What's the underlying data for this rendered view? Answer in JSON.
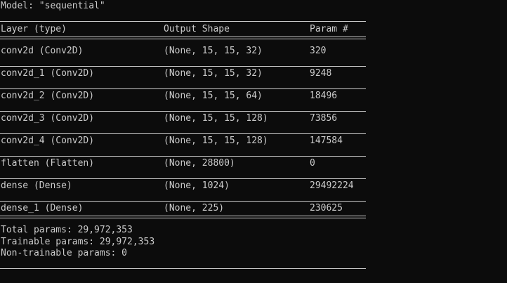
{
  "model_line": "Model: \"sequential\"",
  "header": {
    "layer": "Layer (type)",
    "output_shape": "Output Shape",
    "param": "Param #"
  },
  "layers": [
    {
      "name": "conv2d (Conv2D)",
      "shape": "(None, 15, 15, 32)",
      "param": "320"
    },
    {
      "name": "conv2d_1 (Conv2D)",
      "shape": "(None, 15, 15, 32)",
      "param": "9248"
    },
    {
      "name": "conv2d_2 (Conv2D)",
      "shape": "(None, 15, 15, 64)",
      "param": "18496"
    },
    {
      "name": "conv2d_3 (Conv2D)",
      "shape": "(None, 15, 15, 128)",
      "param": "73856"
    },
    {
      "name": "conv2d_4 (Conv2D)",
      "shape": "(None, 15, 15, 128)",
      "param": "147584"
    },
    {
      "name": "flatten (Flatten)",
      "shape": "(None, 28800)",
      "param": "0"
    },
    {
      "name": "dense (Dense)",
      "shape": "(None, 1024)",
      "param": "29492224"
    },
    {
      "name": "dense_1 (Dense)",
      "shape": "(None, 225)",
      "param": "230625"
    }
  ],
  "summary": {
    "total": "Total params: 29,972,353",
    "trainable": "Trainable params: 29,972,353",
    "non_trainable": "Non-trainable params: 0"
  },
  "colors": {
    "background": "#0c0c0c",
    "text": "#cccccc"
  }
}
